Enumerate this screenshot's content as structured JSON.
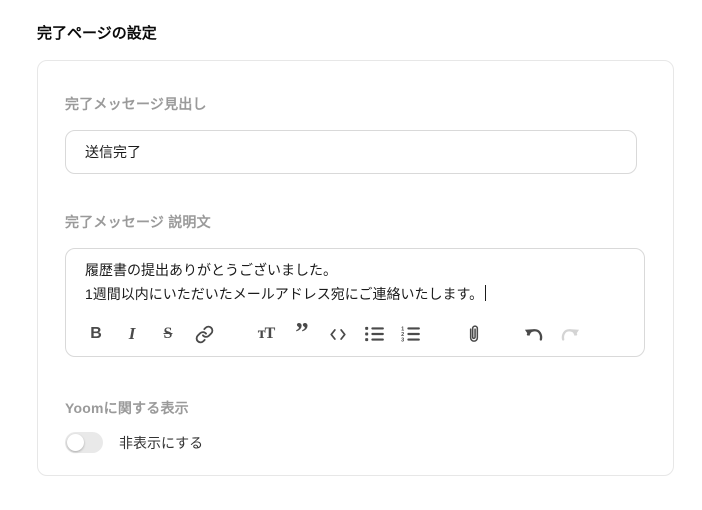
{
  "page_title": "完了ページの設定",
  "card": {
    "heading_field": {
      "label": "完了メッセージ見出し",
      "value": "送信完了"
    },
    "description_field": {
      "label": "完了メッセージ 説明文",
      "line1": "履歴書の提出ありがとうございました。",
      "line2": "1週間以内にいただいたメールアドレス宛にご連絡いたします。"
    },
    "toolbar": {
      "bold_glyph": "B",
      "italic_glyph": "I",
      "strike_glyph": "S",
      "heading_glyph": "тT",
      "quote_glyph": "”",
      "icons": [
        "bold-icon",
        "italic-icon",
        "strikethrough-icon",
        "link-icon",
        "heading-icon",
        "quote-icon",
        "code-icon",
        "bullet-list-icon",
        "numbered-list-icon",
        "attachment-icon",
        "undo-icon",
        "redo-icon"
      ],
      "redo_state": "disabled"
    },
    "yoom_section": {
      "label": "Yoomに関する表示",
      "toggle_label": "非表示にする",
      "toggle_state": "off"
    }
  },
  "colors": {
    "label_gray": "#9a9a9a",
    "text_dark": "#1b1b1b",
    "card_border": "#e7e7e7",
    "input_border": "#d9d9d9",
    "icon_dark": "#4a4a4a",
    "icon_disabled": "#d4d4d4",
    "toggle_track": "#e9e9e9",
    "toggle_knob": "#ffffff"
  }
}
